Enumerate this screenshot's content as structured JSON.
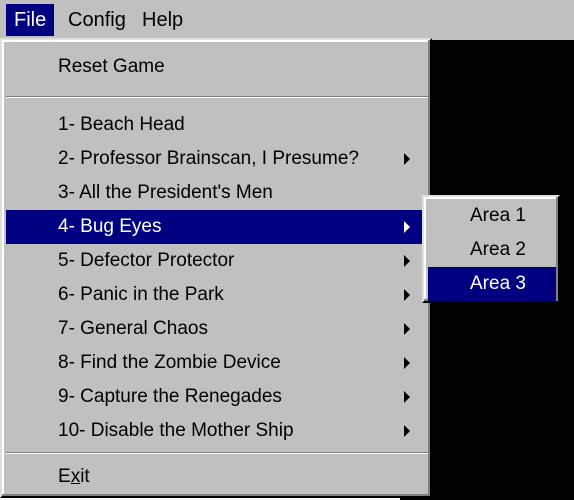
{
  "menubar": {
    "items": [
      {
        "label": "File"
      },
      {
        "label": "Config"
      },
      {
        "label": "Help"
      }
    ]
  },
  "file_menu": {
    "reset": "Reset Game",
    "missions": [
      {
        "label": "1- Beach Head",
        "has_submenu": false
      },
      {
        "label": "2- Professor Brainscan, I Presume?",
        "has_submenu": true
      },
      {
        "label": "3- All the President's Men",
        "has_submenu": false
      },
      {
        "label": "4- Bug Eyes",
        "has_submenu": true,
        "highlighted": true
      },
      {
        "label": "5- Defector Protector",
        "has_submenu": true
      },
      {
        "label": "6- Panic in the Park",
        "has_submenu": true
      },
      {
        "label": "7- General Chaos",
        "has_submenu": true
      },
      {
        "label": "8- Find the Zombie Device",
        "has_submenu": true
      },
      {
        "label": "9- Capture the Renegades",
        "has_submenu": true
      },
      {
        "label": "10- Disable the Mother Ship",
        "has_submenu": true
      }
    ],
    "exit": {
      "pre": "E",
      "mnemonic": "x",
      "post": "it"
    }
  },
  "submenu": {
    "items": [
      {
        "label": "Area 1"
      },
      {
        "label": "Area 2"
      },
      {
        "label": "Area 3",
        "highlighted": true
      }
    ]
  },
  "colors": {
    "menu_face": "#c0c0c0",
    "highlight": "#000080",
    "background": "#000000"
  }
}
